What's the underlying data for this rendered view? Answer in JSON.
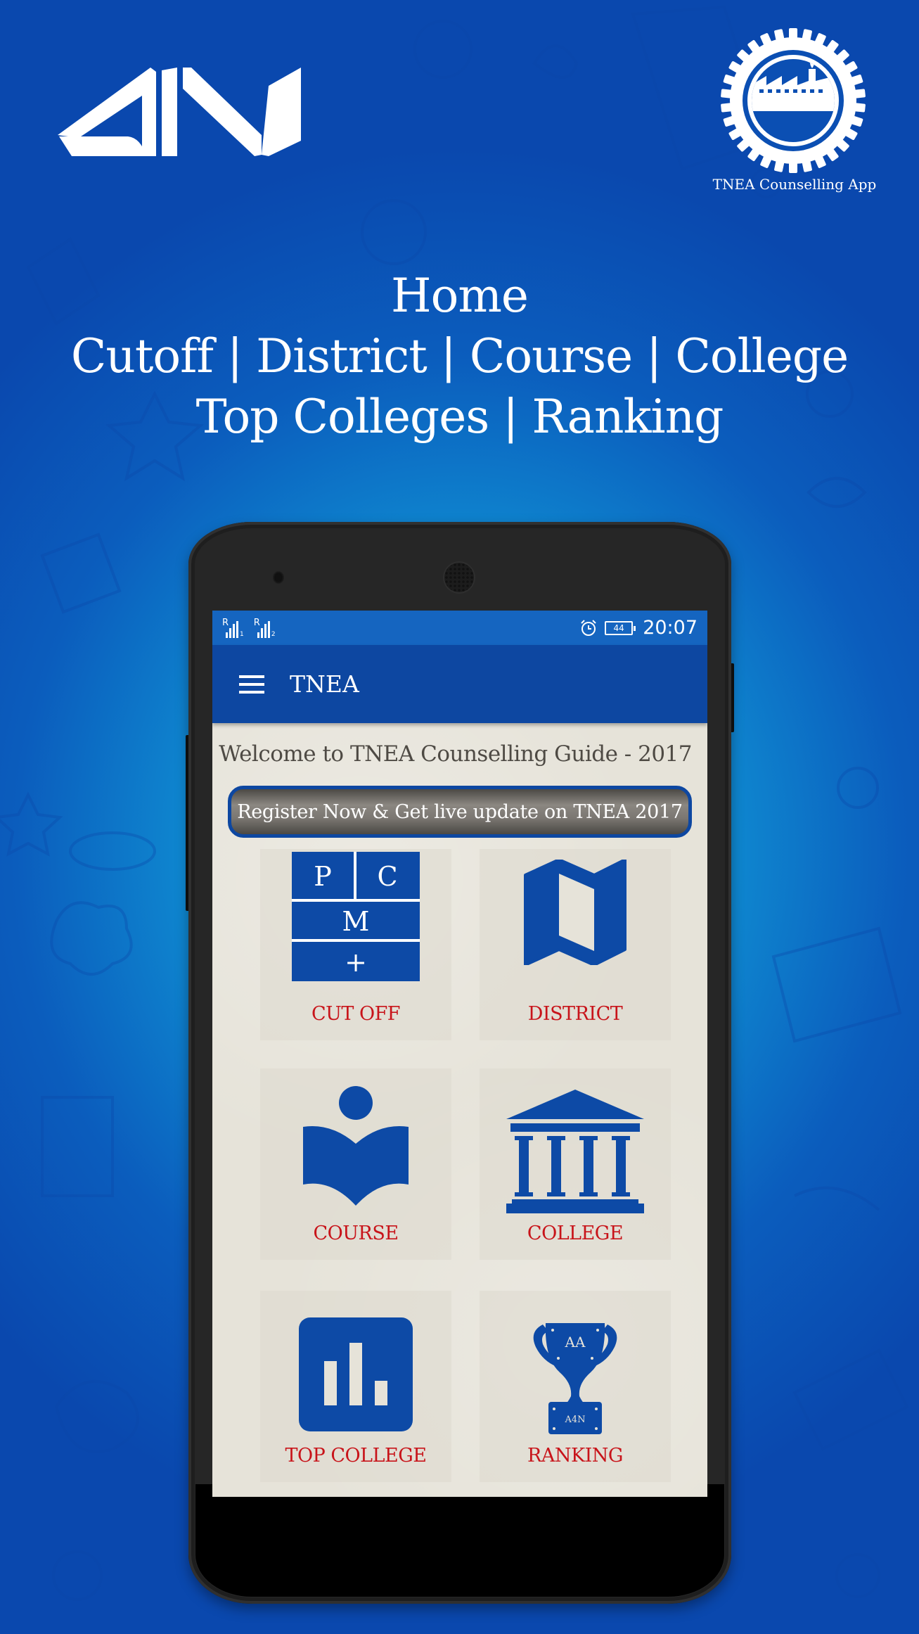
{
  "branding": {
    "left_logo_text": "AIN",
    "app_badge_caption": "TNEA Counselling App"
  },
  "hero": {
    "line1": "Home",
    "line2": "Cutoff | District | Course | College",
    "line3": "Top Colleges | Ranking"
  },
  "statusbar": {
    "sim1": {
      "roaming": "R",
      "slot": "1"
    },
    "sim2": {
      "roaming": "R",
      "slot": "2"
    },
    "alarm_icon": "alarm-clock-icon",
    "battery_level": "44",
    "time": "20:07"
  },
  "appbar": {
    "menu_icon": "hamburger-menu-icon",
    "title": "TNEA"
  },
  "main": {
    "welcome_text": "Welcome to TNEA Counselling Guide - 2017",
    "register_button": "Register Now & Get live update on TNEA 2017",
    "tiles": [
      {
        "label": "CUT OFF",
        "icon": "pcm-grid-icon",
        "icon_letters": [
          "P",
          "C",
          "M",
          "+"
        ]
      },
      {
        "label": "DISTRICT",
        "icon": "folded-map-icon"
      },
      {
        "label": "COURSE",
        "icon": "reader-book-icon"
      },
      {
        "label": "COLLEGE",
        "icon": "institution-building-icon"
      },
      {
        "label": "TOP COLLEGE",
        "icon": "bar-chart-icon"
      },
      {
        "label": "RANKING",
        "icon": "trophy-icon",
        "icon_letters": [
          "AA",
          "A4N"
        ]
      }
    ]
  },
  "colors": {
    "primary_dark": "#0d47a1",
    "statusbar": "#1565c0",
    "icon_blue": "#0d4aa6",
    "label_red": "#c8141a",
    "content_bg": "#e6e3d9"
  }
}
